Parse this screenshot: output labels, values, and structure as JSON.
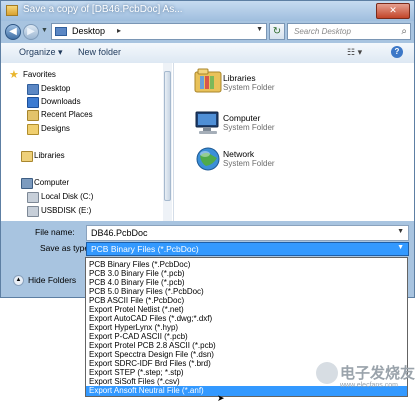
{
  "window": {
    "title": "Save a copy of [DB46.PcbDoc] As..."
  },
  "address": {
    "location": "Desktop"
  },
  "search": {
    "placeholder": "Search Desktop"
  },
  "toolbar": {
    "organize": "Organize ▾",
    "new_folder": "New folder"
  },
  "nav_pane": {
    "favorites": "Favorites",
    "favorites_items": [
      "Desktop",
      "Downloads",
      "Recent Places",
      "Designs"
    ],
    "libraries": "Libraries",
    "computer": "Computer",
    "computer_items": [
      "Local Disk (C:)",
      "USBDISK (E:)"
    ]
  },
  "content_items": [
    {
      "name": "Libraries",
      "type": "System Folder",
      "icon": "libraries-icon"
    },
    {
      "name": "Computer",
      "type": "System Folder",
      "icon": "computer-icon"
    },
    {
      "name": "Network",
      "type": "System Folder",
      "icon": "network-icon"
    }
  ],
  "form": {
    "file_name_label": "File name:",
    "file_name_value": "DB46.PcbDoc",
    "save_type_label": "Save as type:",
    "save_type_value": "PCB Binary Files (*.PcbDoc)",
    "hide_folders": "Hide Folders"
  },
  "save_types": [
    "PCB Binary Files (*.PcbDoc)",
    "PCB 3.0 Binary File (*.pcb)",
    "PCB 4.0 Binary File (*.pcb)",
    "PCB 5.0 Binary Files (*.PcbDoc)",
    "PCB ASCII File (*.PcbDoc)",
    "Export Protel Netlist (*.net)",
    "Export AutoCAD Files (*.dwg;*.dxf)",
    "Export HyperLynx (*.hyp)",
    "Export P-CAD ASCII (*.pcb)",
    "Export Protel PCB 2.8 ASCII (*.pcb)",
    "Export Specctra Design File (*.dsn)",
    "Export SDRC-IDF Brd Files (*.brd)",
    "Export STEP (*.step; *.stp)",
    "Export SiSoft Files (*.csv)",
    "Export Ansoft Neutral File (*.anf)"
  ],
  "selected_save_type": "Export Ansoft Neutral File (*.anf)",
  "watermark": {
    "brand": "电子发烧友",
    "url": "www.elecfans.com"
  },
  "colors": {
    "selection": "#3399ff",
    "frame": "#a8c4e0"
  }
}
